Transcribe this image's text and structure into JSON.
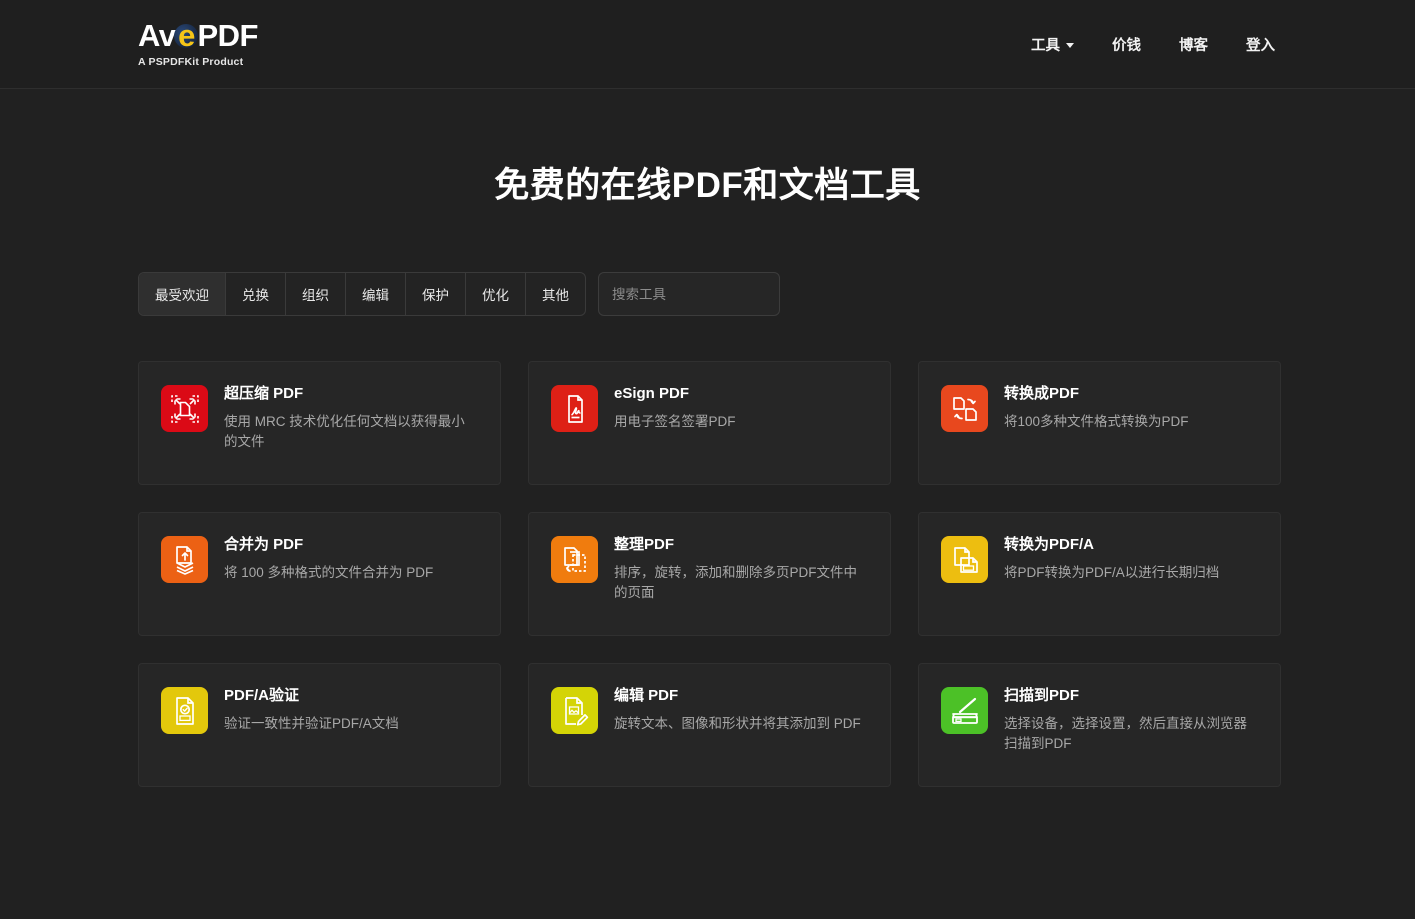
{
  "header": {
    "logo": {
      "pre": "Av",
      "accent": "e",
      "post": "PDF",
      "tagline": "A PSPDFKit Product"
    },
    "nav": [
      {
        "label": "工具",
        "icon": "chevron-down-icon",
        "has_caret": true
      },
      {
        "label": "价钱",
        "has_caret": false
      },
      {
        "label": "博客",
        "has_caret": false
      },
      {
        "label": "登入",
        "has_caret": false
      }
    ]
  },
  "main": {
    "title": "免费的在线PDF和文档工具",
    "tabs": [
      {
        "label": "最受欢迎",
        "active": true
      },
      {
        "label": "兑换",
        "active": false
      },
      {
        "label": "组织",
        "active": false
      },
      {
        "label": "编辑",
        "active": false
      },
      {
        "label": "保护",
        "active": false
      },
      {
        "label": "优化",
        "active": false
      },
      {
        "label": "其他",
        "active": false
      }
    ],
    "search": {
      "value": "",
      "placeholder": "搜索工具"
    },
    "cards": [
      {
        "title": "超压缩 PDF",
        "desc": "使用 MRC 技术优化任何文档以获得最小的文件",
        "icon": "compress-document-icon",
        "color": "#DB0A16"
      },
      {
        "title": "eSign PDF",
        "desc": "用电子签名签署PDF",
        "icon": "signature-document-icon",
        "color": "#DE2016"
      },
      {
        "title": "转换成PDF",
        "desc": "将100多种文件格式转换为PDF",
        "icon": "convert-to-pdf-icon",
        "color": "#E8481E"
      },
      {
        "title": "合并为 PDF",
        "desc": "将 100 多种格式的文件合并为 PDF",
        "icon": "merge-documents-icon",
        "color": "#EC6114"
      },
      {
        "title": "整理PDF",
        "desc": "排序，旋转，添加和删除多页PDF文件中的页面",
        "icon": "organize-pages-icon",
        "color": "#F07C0E"
      },
      {
        "title": "转换为PDF/A",
        "desc": "将PDF转换为PDF/A以进行长期归档",
        "icon": "pdfa-convert-icon",
        "color": "#EDBE10"
      },
      {
        "title": "PDF/A验证",
        "desc": "验证一致性并验证PDF/A文档",
        "icon": "pdfa-validate-icon",
        "color": "#E3C80C"
      },
      {
        "title": "编辑 PDF",
        "desc": "旋转文本、图像和形状并将其添加到 PDF",
        "icon": "edit-pdf-icon",
        "color": "#D4D406"
      },
      {
        "title": "扫描到PDF",
        "desc": "选择设备，选择设置，然后直接从浏览器扫描到PDF",
        "icon": "scanner-icon",
        "color": "#4CC127"
      }
    ]
  },
  "colors": {
    "page_bg": "#212121",
    "header_bg": "#1f1f1f",
    "card_bg": "#262626",
    "text_primary": "#ffffff",
    "text_muted": "#a8a8a8",
    "logo_accent": "#f5c518"
  }
}
